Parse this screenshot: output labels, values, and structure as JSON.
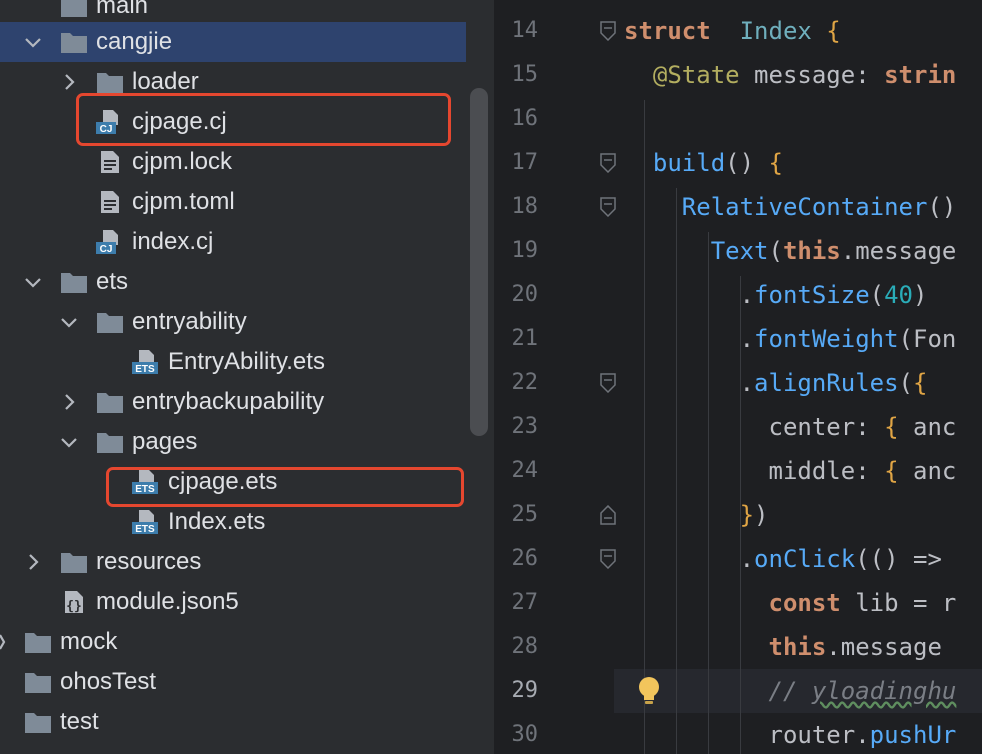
{
  "tree": {
    "items": [
      {
        "label": "main",
        "type": "folder",
        "expanded": true
      },
      {
        "label": "cangjie",
        "type": "folder",
        "expanded": true,
        "selected": true
      },
      {
        "label": "loader",
        "type": "folder",
        "expanded": false
      },
      {
        "label": "cjpage.cj",
        "type": "file",
        "icon": "cj-file-icon",
        "badge": "CJ",
        "highlighted": true
      },
      {
        "label": "cjpm.lock",
        "type": "file",
        "icon": "text-file-icon"
      },
      {
        "label": "cjpm.toml",
        "type": "file",
        "icon": "text-file-icon"
      },
      {
        "label": "index.cj",
        "type": "file",
        "icon": "cj-file-icon",
        "badge": "CJ"
      },
      {
        "label": "ets",
        "type": "folder",
        "expanded": true
      },
      {
        "label": "entryability",
        "type": "folder",
        "expanded": true
      },
      {
        "label": "EntryAbility.ets",
        "type": "file",
        "icon": "ets-file-icon",
        "badge": "ETS"
      },
      {
        "label": "entrybackupability",
        "type": "folder",
        "expanded": false
      },
      {
        "label": "pages",
        "type": "folder",
        "expanded": true
      },
      {
        "label": "cjpage.ets",
        "type": "file",
        "icon": "ets-file-icon",
        "badge": "ETS",
        "highlighted": true
      },
      {
        "label": "Index.ets",
        "type": "file",
        "icon": "ets-file-icon",
        "badge": "ETS"
      },
      {
        "label": "resources",
        "type": "folder",
        "expanded": false
      },
      {
        "label": "module.json5",
        "type": "file",
        "icon": "json-file-icon"
      },
      {
        "label": "mock",
        "type": "folder"
      },
      {
        "label": "ohosTest",
        "type": "folder"
      },
      {
        "label": "test",
        "type": "folder"
      }
    ]
  },
  "editor": {
    "current_line": 29,
    "lines": [
      {
        "n": "14",
        "tokens": [
          [
            "kw",
            "struct"
          ],
          [
            "",
            "  "
          ],
          [
            "ty",
            "Index"
          ],
          [
            "",
            ""
          ],
          [
            "br",
            " {"
          ]
        ]
      },
      {
        "n": "15",
        "tokens": [
          [
            "",
            "  "
          ],
          [
            "an",
            "@State"
          ],
          [
            "",
            " message: "
          ],
          [
            "kw",
            "strin"
          ]
        ]
      },
      {
        "n": "16",
        "tokens": []
      },
      {
        "n": "17",
        "tokens": [
          [
            "",
            "  "
          ],
          [
            "fn",
            "build"
          ],
          [
            "",
            "() "
          ],
          [
            "br",
            "{"
          ]
        ]
      },
      {
        "n": "18",
        "tokens": [
          [
            "",
            "    "
          ],
          [
            "fn",
            "RelativeContainer"
          ],
          [
            "",
            "()"
          ]
        ]
      },
      {
        "n": "19",
        "tokens": [
          [
            "",
            "      "
          ],
          [
            "fn",
            "Text"
          ],
          [
            "",
            "("
          ],
          [
            "th",
            "this"
          ],
          [
            "",
            ".message"
          ]
        ]
      },
      {
        "n": "20",
        "tokens": [
          [
            "",
            "        ."
          ],
          [
            "fn",
            "fontSize"
          ],
          [
            "",
            "("
          ],
          [
            "num",
            "40"
          ],
          [
            "",
            ")"
          ]
        ]
      },
      {
        "n": "21",
        "tokens": [
          [
            "",
            "        ."
          ],
          [
            "fn",
            "fontWeight"
          ],
          [
            "",
            "(Fon"
          ]
        ]
      },
      {
        "n": "22",
        "tokens": [
          [
            "",
            "        ."
          ],
          [
            "fn",
            "alignRules"
          ],
          [
            "",
            "("
          ],
          [
            "br",
            "{"
          ]
        ]
      },
      {
        "n": "23",
        "tokens": [
          [
            "",
            "          center: "
          ],
          [
            "br",
            "{"
          ],
          [
            "",
            " anc"
          ]
        ]
      },
      {
        "n": "24",
        "tokens": [
          [
            "",
            "          middle: "
          ],
          [
            "br",
            "{"
          ],
          [
            "",
            " anc"
          ]
        ]
      },
      {
        "n": "25",
        "tokens": [
          [
            "",
            "        "
          ],
          [
            "br",
            "}"
          ],
          [
            "",
            ")"
          ]
        ]
      },
      {
        "n": "26",
        "tokens": [
          [
            "",
            "        ."
          ],
          [
            "fn",
            "onClick"
          ],
          [
            "",
            "(() =>"
          ]
        ]
      },
      {
        "n": "27",
        "tokens": [
          [
            "",
            "          "
          ],
          [
            "kw",
            "const"
          ],
          [
            "",
            " lib = r"
          ]
        ]
      },
      {
        "n": "28",
        "tokens": [
          [
            "",
            "          "
          ],
          [
            "th",
            "this"
          ],
          [
            "",
            ".message"
          ]
        ]
      },
      {
        "n": "29",
        "tokens": [
          [
            "",
            "          "
          ],
          [
            "cm",
            "// "
          ],
          [
            "cm cm-wavy",
            "yloadinghu"
          ]
        ]
      },
      {
        "n": "30",
        "tokens": [
          [
            "",
            "          router."
          ],
          [
            "fn",
            "pushUr"
          ]
        ]
      }
    ]
  },
  "colors": {
    "tree_bg": "#2b2d30",
    "editor_bg": "#1e1f22",
    "selection": "#2e436e",
    "highlight_box": "#e5472f"
  }
}
